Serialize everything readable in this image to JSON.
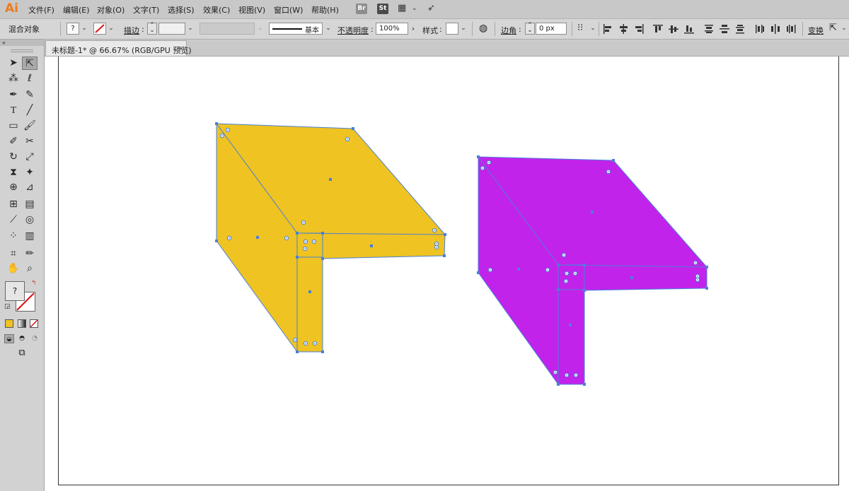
{
  "app": {
    "logo": "Ai"
  },
  "menu": {
    "items": [
      "文件(F)",
      "编辑(E)",
      "对象(O)",
      "文字(T)",
      "选择(S)",
      "效果(C)",
      "视图(V)",
      "窗口(W)",
      "帮助(H)"
    ],
    "bridge_badge": "Br",
    "stock_badge": "St"
  },
  "control_bar": {
    "selection_label": "混合对象",
    "fill_value": "?",
    "stroke_label": "描边",
    "stroke_profile": "基本",
    "opacity_label": "不透明度",
    "opacity_value": "100%",
    "style_label": "样式",
    "corner_label": "边角",
    "corner_value": "0 px",
    "transform_label": "变换"
  },
  "document_tab": {
    "title": "未标题-1* @ 66.67% (RGB/GPU 预览)",
    "close": "×"
  },
  "tools": {
    "fill_unknown": "?"
  },
  "colors": {
    "shape_left": "#EEC322",
    "shape_right": "#C223EB",
    "selection": "#4A7FD8",
    "logo": "#EC7B1E"
  }
}
